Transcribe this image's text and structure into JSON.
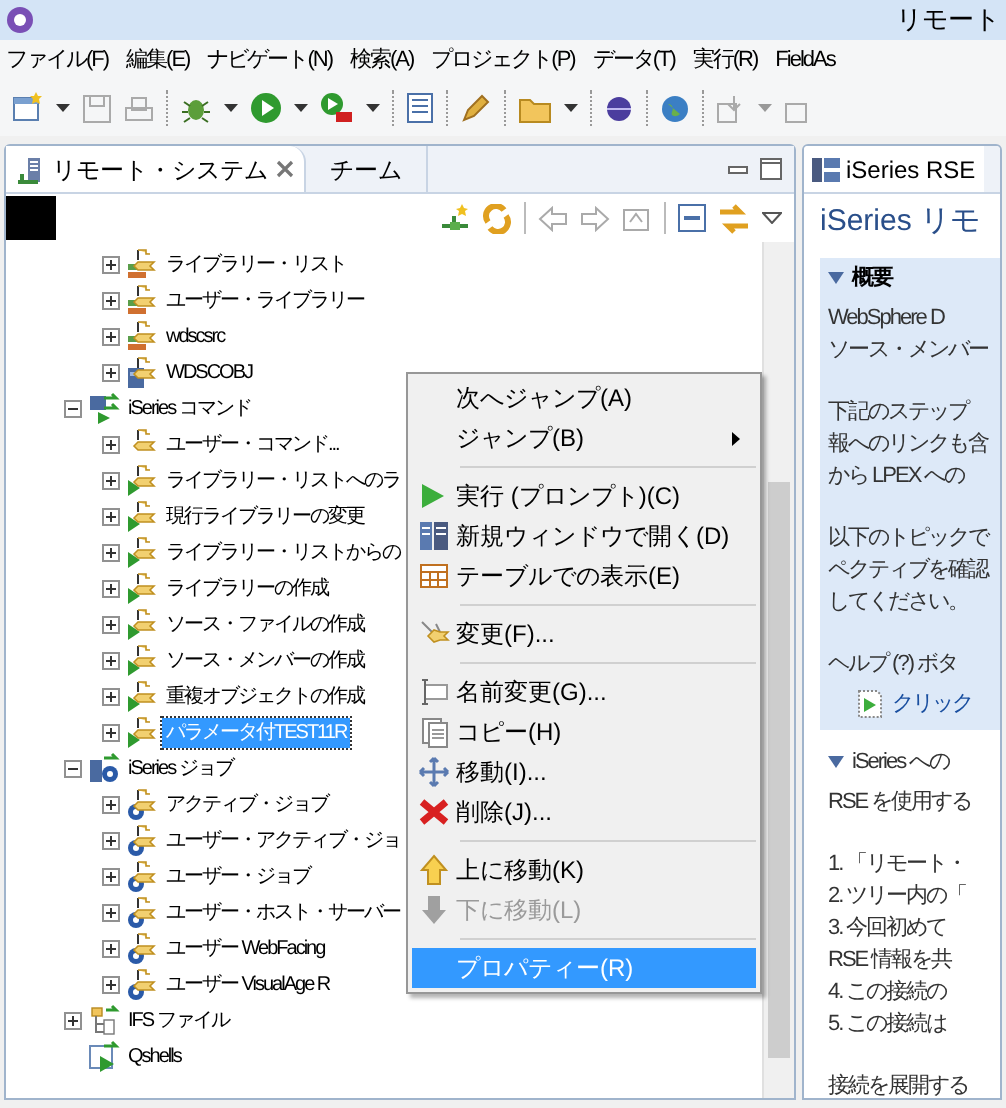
{
  "window": {
    "title": "リモート"
  },
  "menu_bar": [
    "ファイル(F)",
    "編集(E)",
    "ナビゲート(N)",
    "検索(A)",
    "プロジェクト(P)",
    "データ(T)",
    "実行(R)",
    "FieldAs"
  ],
  "left_view": {
    "tabs": [
      {
        "label": "リモート・システム",
        "selected": true,
        "closable": true
      },
      {
        "label": "チーム",
        "selected": false,
        "closable": false
      }
    ],
    "tree": {
      "continued_children": [
        {
          "label": "ライブラリー・リスト",
          "kind": "library",
          "expanded": false,
          "selected": false
        },
        {
          "label": "ユーザー・ライブラリー",
          "kind": "library",
          "expanded": false,
          "selected": false
        },
        {
          "label": "wdscsrc",
          "kind": "library",
          "expanded": false,
          "selected": false
        },
        {
          "label": "WDSCOBJ",
          "kind": "object",
          "expanded": false,
          "selected": false
        }
      ],
      "nodes": [
        {
          "label": "iSeries コマンド",
          "kind": "command-group",
          "expanded": true,
          "selected": false,
          "children": [
            {
              "label": "ユーザー・コマンド...",
              "kind": "command-plain",
              "expanded": false,
              "selected": false
            },
            {
              "label": "ライブラリー・リストへのラ",
              "kind": "command",
              "expanded": false,
              "selected": false
            },
            {
              "label": "現行ライブラリーの変更",
              "kind": "command",
              "expanded": false,
              "selected": false
            },
            {
              "label": "ライブラリー・リストからの",
              "kind": "command",
              "expanded": false,
              "selected": false
            },
            {
              "label": "ライブラリーの作成",
              "kind": "command",
              "expanded": false,
              "selected": false
            },
            {
              "label": "ソース・ファイルの作成",
              "kind": "command",
              "expanded": false,
              "selected": false
            },
            {
              "label": "ソース・メンバーの作成",
              "kind": "command",
              "expanded": false,
              "selected": false
            },
            {
              "label": "重複オブジェクトの作成",
              "kind": "command",
              "expanded": false,
              "selected": false
            },
            {
              "label": "パラメータ付TEST11R",
              "kind": "command",
              "expanded": false,
              "selected": true
            }
          ]
        },
        {
          "label": "iSeries ジョブ",
          "kind": "job-group",
          "expanded": true,
          "selected": false,
          "children": [
            {
              "label": "アクティブ・ジョブ",
              "kind": "job",
              "expanded": false,
              "selected": false
            },
            {
              "label": "ユーザー・アクティブ・ジョ",
              "kind": "job",
              "expanded": false,
              "selected": false
            },
            {
              "label": "ユーザー・ジョブ",
              "kind": "job",
              "expanded": false,
              "selected": false
            },
            {
              "label": "ユーザー・ホスト・サーバー",
              "kind": "job",
              "expanded": false,
              "selected": false
            },
            {
              "label": "ユーザー WebFacing",
              "kind": "job",
              "expanded": false,
              "selected": false
            },
            {
              "label": "ユーザー VisualAge R",
              "kind": "job",
              "expanded": false,
              "selected": false
            }
          ]
        },
        {
          "label": "IFS ファイル",
          "kind": "ifs",
          "expanded": false,
          "selected": false
        },
        {
          "label": "Qshells",
          "kind": "leaf",
          "selected": false
        }
      ]
    }
  },
  "context_menu": [
    {
      "kind": "plain",
      "label": "次へジャンプ(A)",
      "disabled": false,
      "selected": false
    },
    {
      "kind": "submenu",
      "label": "ジャンプ(B)",
      "disabled": false,
      "selected": false
    },
    {
      "kind": "separator"
    },
    {
      "kind": "run",
      "label": "実行 (プロンプト)(C)",
      "disabled": false,
      "selected": false
    },
    {
      "kind": "window",
      "label": "新規ウィンドウで開く(D)",
      "disabled": false,
      "selected": false
    },
    {
      "kind": "table",
      "label": "テーブルでの表示(E)",
      "disabled": false,
      "selected": false
    },
    {
      "kind": "separator"
    },
    {
      "kind": "change",
      "label": "変更(F)...",
      "disabled": false,
      "selected": false
    },
    {
      "kind": "separator"
    },
    {
      "kind": "rename",
      "label": "名前変更(G)...",
      "disabled": false,
      "selected": false
    },
    {
      "kind": "copy",
      "label": "コピー(H)",
      "disabled": false,
      "selected": false
    },
    {
      "kind": "move",
      "label": "移動(I)...",
      "disabled": false,
      "selected": false
    },
    {
      "kind": "delete",
      "label": "削除(J)...",
      "disabled": false,
      "selected": false
    },
    {
      "kind": "separator"
    },
    {
      "kind": "up",
      "label": "上に移動(K)",
      "disabled": false,
      "selected": false
    },
    {
      "kind": "down",
      "label": "下に移動(L)",
      "disabled": true,
      "selected": false
    },
    {
      "kind": "separator"
    },
    {
      "kind": "plain",
      "label": "プロパティー(R)",
      "disabled": false,
      "selected": true
    }
  ],
  "guide": {
    "tab": "iSeries RSE",
    "heading": "iSeries リモ",
    "sections": [
      {
        "title": "概要",
        "expanded": true,
        "highlighted": true,
        "paragraphs": [
          [
            "WebSphere D",
            "ソース・メンバー"
          ],
          [
            "下記のステップ",
            "報へのリンクも含",
            "から LPEX への"
          ],
          [
            "以下のトピックで",
            "ペクティブを確認",
            "してください。"
          ],
          [
            "ヘルプ (?) ボタ"
          ]
        ],
        "link": "クリック"
      },
      {
        "title": "iSeries への",
        "expanded": true,
        "highlighted": false,
        "paragraphs": [
          [
            "RSE を使用する"
          ],
          [
            "1. 「リモート・",
            "2. ツリー内の「",
            "3. 今回初めて",
            "RSE 情報を共",
            "4. この接続の",
            "5. この接続は"
          ],
          [
            "接続を展開する"
          ]
        ]
      }
    ]
  }
}
